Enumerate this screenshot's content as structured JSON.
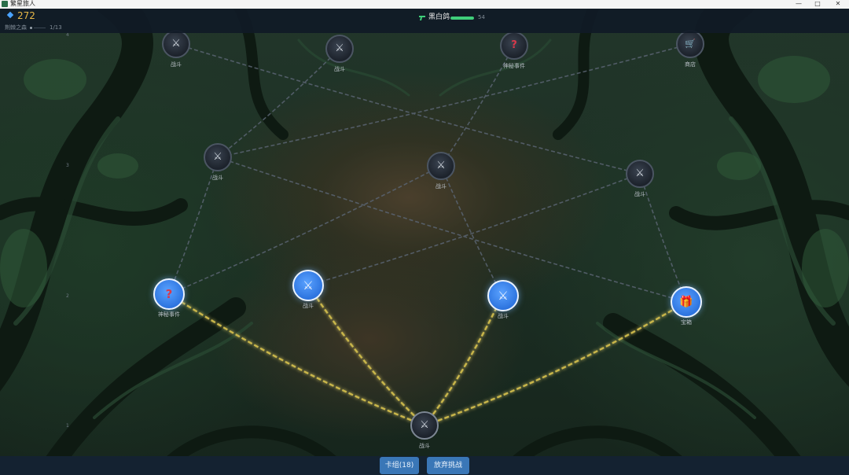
{
  "window": {
    "title": "繁星旅人",
    "controls": [
      "—",
      "□",
      "✕"
    ]
  },
  "hud": {
    "gold": "272",
    "stage_name": "荆棘之森",
    "stage_progress": "1/13",
    "player_name": "黑白鸽",
    "hp_value": "54",
    "hp_fraction": 1.0
  },
  "map": {
    "row_markers": [
      "4",
      "3",
      "2",
      "1"
    ],
    "nodes": [
      {
        "id": "r4a",
        "type": "battle",
        "label": "战斗",
        "state": "locked",
        "icon": "crossed-swords-icon"
      },
      {
        "id": "r4b",
        "type": "battle",
        "label": "战斗",
        "state": "locked",
        "icon": "crossed-swords-icon"
      },
      {
        "id": "r4c",
        "type": "mystery",
        "label": "神秘事件",
        "state": "locked",
        "icon": "question-mark-icon"
      },
      {
        "id": "r4d",
        "type": "shop",
        "label": "商店",
        "state": "locked",
        "icon": "shopping-cart-icon"
      },
      {
        "id": "r3a",
        "type": "battle",
        "label": "战斗",
        "state": "locked",
        "icon": "crossed-swords-icon"
      },
      {
        "id": "r3b",
        "type": "battle",
        "label": "战斗",
        "state": "locked",
        "icon": "crossed-swords-icon"
      },
      {
        "id": "r3c",
        "type": "battle",
        "label": "战斗",
        "state": "locked",
        "icon": "crossed-swords-icon"
      },
      {
        "id": "r2a",
        "type": "mystery",
        "label": "神秘事件",
        "state": "available",
        "icon": "question-mark-icon"
      },
      {
        "id": "r2b",
        "type": "battle",
        "label": "战斗",
        "state": "available",
        "icon": "crossed-swords-icon"
      },
      {
        "id": "r2c",
        "type": "battle",
        "label": "战斗",
        "state": "available",
        "icon": "crossed-swords-icon"
      },
      {
        "id": "r2d",
        "type": "treasure",
        "label": "宝箱",
        "state": "available",
        "icon": "gift-box-icon"
      },
      {
        "id": "r1a",
        "type": "battle",
        "label": "战斗",
        "state": "current",
        "icon": "crossed-swords-icon"
      }
    ]
  },
  "bottom_bar": {
    "deck_button": "卡组(18)",
    "abandon_button": "放弃挑战"
  },
  "colors": {
    "available_node": "#2d74df",
    "path_active": "#c9b64a",
    "path_inactive": "#5a6472",
    "gold": "#e8b848",
    "hp": "#3fcf7a",
    "button": "#3a77b7"
  }
}
